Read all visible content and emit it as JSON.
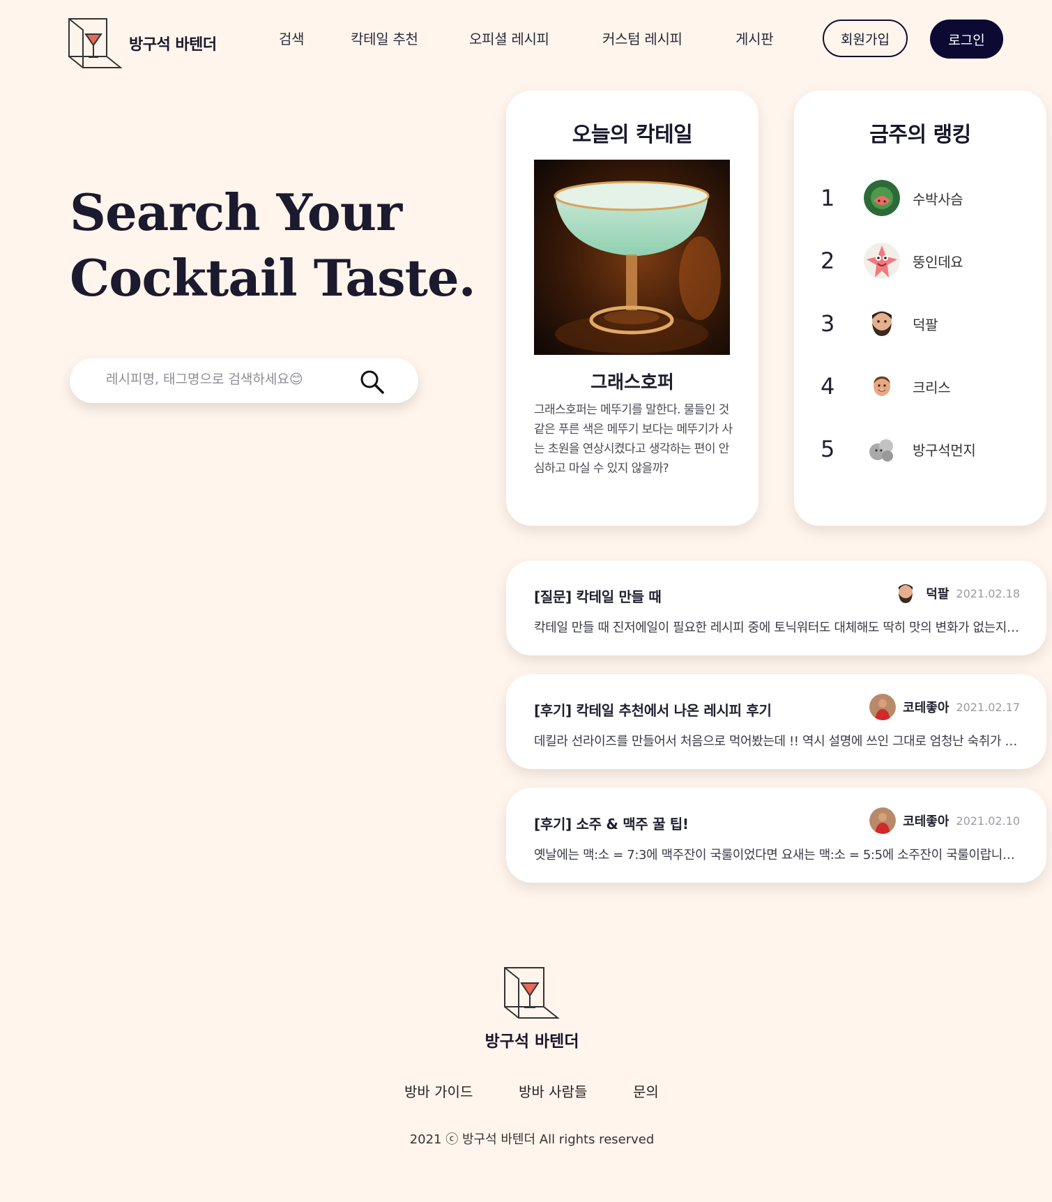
{
  "brand": {
    "name": "방구석 바텐더"
  },
  "nav": {
    "items": [
      "검색",
      "칵테일 추천",
      "오피셜 레시피",
      "커스텀 레시피",
      "게시판"
    ],
    "signup": "회원가입",
    "login": "로그인"
  },
  "hero": {
    "line1": "Search Your",
    "line2": "Cocktail Taste."
  },
  "search": {
    "placeholder": "레시피명, 태그명으로 검색하세요😊"
  },
  "today": {
    "title": "오늘의 칵테일",
    "name": "그래스호퍼",
    "description": "그래스호퍼는 메뚜기를 말한다. 물들인 것 같은 푸른 색은 메뚜기 보다는 메뚜기가 사는 초원을 연상시켰다고 생각하는 편이 안심하고 마실 수 있지 않을까?"
  },
  "ranking": {
    "title": "금주의 랭킹",
    "items": [
      {
        "rank": "1",
        "name": "수박사슴",
        "avatar": "watermelon-avatar",
        "color": "#2d6a3a"
      },
      {
        "rank": "2",
        "name": "뚱인데요",
        "avatar": "starfish-avatar",
        "color": "#f07a7e"
      },
      {
        "rank": "3",
        "name": "덕팔",
        "avatar": "bearded-man-avatar",
        "color": "#6b4a3a"
      },
      {
        "rank": "4",
        "name": "크리스",
        "avatar": "smiling-man-avatar",
        "color": "#e0a080"
      },
      {
        "rank": "5",
        "name": "방구석먼지",
        "avatar": "dust-avatar",
        "color": "#b8b8b8"
      }
    ]
  },
  "board": {
    "posts": [
      {
        "title": "[질문] 칵테일 만들 때",
        "author": "덕팔",
        "date": "2021.02.18",
        "body": "칵테일 만들 때 진저에일이 필요한 레시피 중에 토닉워터도 대체해도 딱히 맛의 변화가 없는지 궁금합니다"
      },
      {
        "title": "[후기] 칵테일 추천에서 나온 레시피 후기",
        "author": "코테좋아",
        "date": "2021.02.17",
        "body": "데킬라 선라이즈를 만들어서 처음으로 먹어봤는데 !! 역시 설명에 쓰인 그대로 엄청난 숙취가 기다리고 있었습니다"
      },
      {
        "title": "[후기] 소주 & 맥주 꿀 팁!",
        "author": "코테좋아",
        "date": "2021.02.10",
        "body": "옛날에는 맥:소 = 7:3에 맥주잔이 국룰이었다면 요새는 맥:소 = 5:5에 소주잔이 국룰이랍니다 한번 드셔보세요"
      }
    ]
  },
  "footer": {
    "brand": "방구석 바텐더",
    "links": [
      "방바 가이드",
      "방바 사람들",
      "문의"
    ],
    "copyright": "2021 ⓒ 방구석 바텐더 All rights reserved"
  },
  "colors": {
    "background": "#fff5ec",
    "accent": "#0c0a33",
    "card": "#ffffff"
  }
}
